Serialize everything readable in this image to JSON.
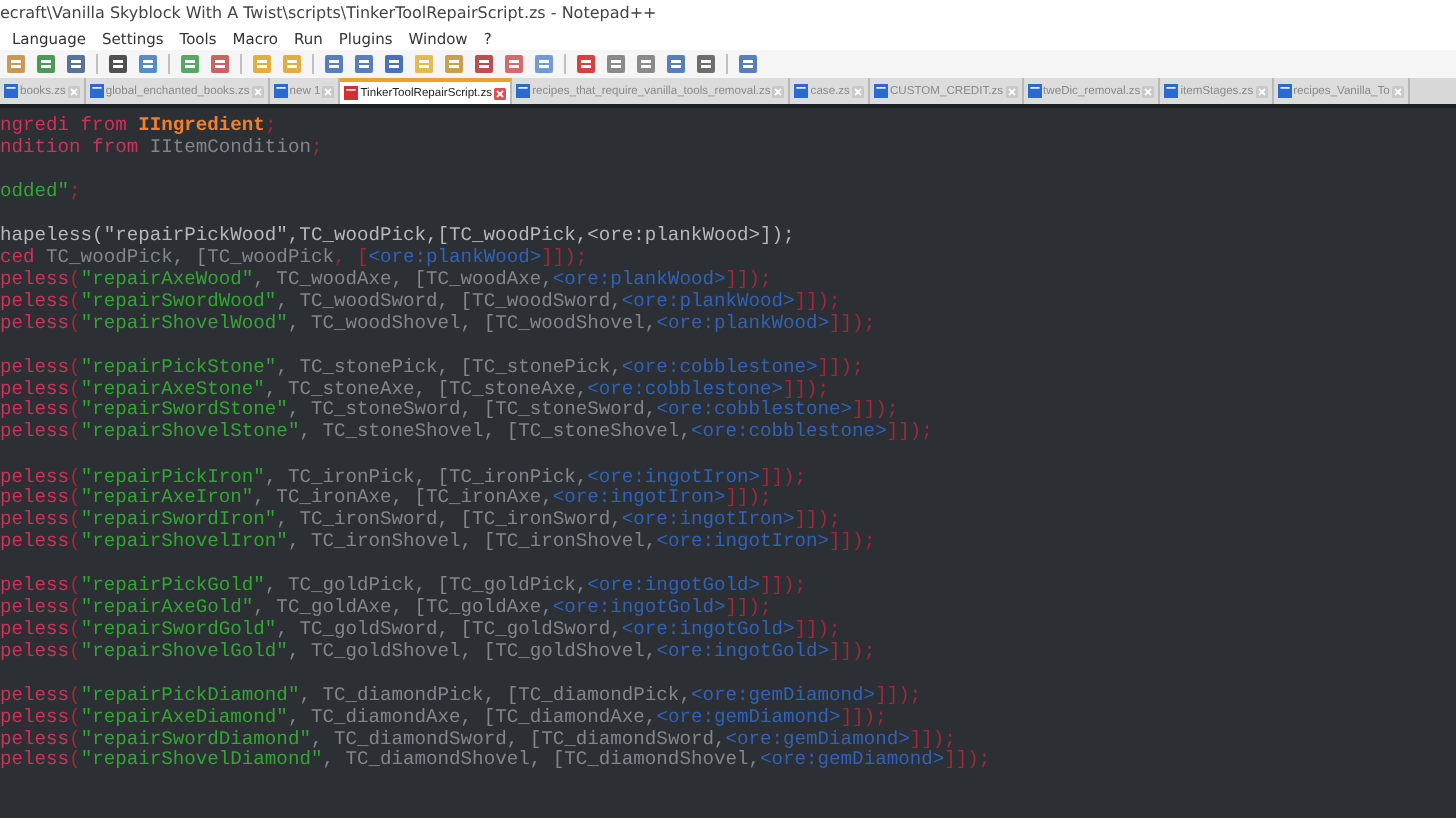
{
  "window": {
    "title": "ecraft\\Vanilla Skyblock With A Twist\\scripts\\TinkerToolRepairScript.zs - Notepad++"
  },
  "menu": [
    "Language",
    "Settings",
    "Tools",
    "Macro",
    "Run",
    "Plugins",
    "Window",
    "?"
  ],
  "tabs": [
    {
      "label": "books.zs",
      "selected": false
    },
    {
      "label": "global_enchanted_books.zs",
      "selected": false
    },
    {
      "label": "new 1",
      "selected": false
    },
    {
      "label": "TinkerToolRepairScript.zs",
      "selected": true
    },
    {
      "label": "recipes_that_require_vanilla_tools_removal.zs",
      "selected": false
    },
    {
      "label": "case.zs",
      "selected": false
    },
    {
      "label": "CUSTOM_CREDIT.zs",
      "selected": false
    },
    {
      "label": "tweDic_removal.zs",
      "selected": false
    },
    {
      "label": "itemStages.zs",
      "selected": false
    },
    {
      "label": "recipes_Vanilla_To",
      "selected": false
    }
  ],
  "code_blocks": [
    [
      [
        {
          "kind": "keyword",
          "text": "ngredi"
        },
        {
          "kind": "keyword",
          "text": " from "
        },
        {
          "kind": "type",
          "text": "IIngredient"
        },
        {
          "kind": "punct",
          "text": ";"
        }
      ],
      [
        {
          "kind": "keyword",
          "text": "ndition"
        },
        {
          "kind": "keyword",
          "text": " from "
        },
        {
          "kind": "plain",
          "text": "IItemCondition"
        },
        {
          "kind": "punct",
          "text": ";"
        }
      ]
    ],
    [
      [
        {
          "kind": "string",
          "text": "odded\""
        },
        {
          "kind": "punct",
          "text": ";"
        }
      ]
    ],
    [
      [
        {
          "kind": "comment",
          "text": "hapeless(\"repairPickWood\",TC_woodPick,[TC_woodPick,<ore:plankWood>]);"
        }
      ],
      [
        {
          "kind": "keyword",
          "text": "ced"
        },
        {
          "kind": "plain",
          "text": " TC_woodPick, [TC_woodPick"
        },
        {
          "kind": "punct",
          "text": ", ["
        },
        {
          "kind": "ore",
          "text": "<ore:plankWood>"
        },
        {
          "kind": "punct",
          "text": "]]);"
        }
      ],
      [
        {
          "kind": "keyword",
          "text": "peless"
        },
        {
          "kind": "punct",
          "text": "("
        },
        {
          "kind": "string",
          "text": "\"repairAxeWood\""
        },
        {
          "kind": "plain",
          "text": ", TC_woodAxe, [TC_woodAxe,"
        },
        {
          "kind": "ore",
          "text": "<ore:plankWood>"
        },
        {
          "kind": "punct",
          "text": "]]);"
        }
      ],
      [
        {
          "kind": "keyword",
          "text": "peless"
        },
        {
          "kind": "punct",
          "text": "("
        },
        {
          "kind": "string",
          "text": "\"repairSwordWood\""
        },
        {
          "kind": "plain",
          "text": ", TC_woodSword, [TC_woodSword,"
        },
        {
          "kind": "ore",
          "text": "<ore:plankWood>"
        },
        {
          "kind": "punct",
          "text": "]]);"
        }
      ],
      [
        {
          "kind": "keyword",
          "text": "peless"
        },
        {
          "kind": "punct",
          "text": "("
        },
        {
          "kind": "string",
          "text": "\"repairShovelWood\""
        },
        {
          "kind": "plain",
          "text": ", TC_woodShovel, [TC_woodShovel,"
        },
        {
          "kind": "ore",
          "text": "<ore:plankWood>"
        },
        {
          "kind": "punct",
          "text": "]]);"
        }
      ]
    ],
    [
      [
        {
          "kind": "keyword",
          "text": "peless"
        },
        {
          "kind": "punct",
          "text": "("
        },
        {
          "kind": "string",
          "text": "\"repairPickStone\""
        },
        {
          "kind": "plain",
          "text": ", TC_stonePick, [TC_stonePick,"
        },
        {
          "kind": "ore",
          "text": "<ore:cobblestone>"
        },
        {
          "kind": "punct",
          "text": "]]);"
        }
      ],
      [
        {
          "kind": "keyword",
          "text": "peless"
        },
        {
          "kind": "punct",
          "text": "("
        },
        {
          "kind": "string",
          "text": "\"repairAxeStone\""
        },
        {
          "kind": "plain",
          "text": ", TC_stoneAxe, [TC_stoneAxe,"
        },
        {
          "kind": "ore",
          "text": "<ore:cobblestone>"
        },
        {
          "kind": "punct",
          "text": "]]);"
        }
      ],
      [
        {
          "kind": "keyword",
          "text": "peless"
        },
        {
          "kind": "punct",
          "text": "("
        },
        {
          "kind": "string",
          "text": "\"repairSwordStone\""
        },
        {
          "kind": "plain",
          "text": ", TC_stoneSword, [TC_stoneSword,"
        },
        {
          "kind": "ore",
          "text": "<ore:cobblestone>"
        },
        {
          "kind": "punct",
          "text": "]]);"
        }
      ],
      [
        {
          "kind": "keyword",
          "text": "peless"
        },
        {
          "kind": "punct",
          "text": "("
        },
        {
          "kind": "string",
          "text": "\"repairShovelStone\""
        },
        {
          "kind": "plain",
          "text": ", TC_stoneShovel, [TC_stoneShovel,"
        },
        {
          "kind": "ore",
          "text": "<ore:cobblestone>"
        },
        {
          "kind": "punct",
          "text": "]]);"
        }
      ]
    ],
    [
      [
        {
          "kind": "keyword",
          "text": "peless"
        },
        {
          "kind": "punct",
          "text": "("
        },
        {
          "kind": "string",
          "text": "\"repairPickIron\""
        },
        {
          "kind": "plain",
          "text": ", TC_ironPick, [TC_ironPick,"
        },
        {
          "kind": "ore",
          "text": "<ore:ingotIron>"
        },
        {
          "kind": "punct",
          "text": "]]);"
        }
      ],
      [
        {
          "kind": "keyword",
          "text": "peless"
        },
        {
          "kind": "punct",
          "text": "("
        },
        {
          "kind": "string",
          "text": "\"repairAxeIron\""
        },
        {
          "kind": "plain",
          "text": ", TC_ironAxe, [TC_ironAxe,"
        },
        {
          "kind": "ore",
          "text": "<ore:ingotIron>"
        },
        {
          "kind": "punct",
          "text": "]]);"
        }
      ],
      [
        {
          "kind": "keyword",
          "text": "peless"
        },
        {
          "kind": "punct",
          "text": "("
        },
        {
          "kind": "string",
          "text": "\"repairSwordIron\""
        },
        {
          "kind": "plain",
          "text": ", TC_ironSword, [TC_ironSword,"
        },
        {
          "kind": "ore",
          "text": "<ore:ingotIron>"
        },
        {
          "kind": "punct",
          "text": "]]);"
        }
      ],
      [
        {
          "kind": "keyword",
          "text": "peless"
        },
        {
          "kind": "punct",
          "text": "("
        },
        {
          "kind": "string",
          "text": "\"repairShovelIron\""
        },
        {
          "kind": "plain",
          "text": ", TC_ironShovel, [TC_ironShovel,"
        },
        {
          "kind": "ore",
          "text": "<ore:ingotIron>"
        },
        {
          "kind": "punct",
          "text": "]]);"
        }
      ]
    ],
    [
      [
        {
          "kind": "keyword",
          "text": "peless"
        },
        {
          "kind": "punct",
          "text": "("
        },
        {
          "kind": "string",
          "text": "\"repairPickGold\""
        },
        {
          "kind": "plain",
          "text": ", TC_goldPick, [TC_goldPick,"
        },
        {
          "kind": "ore",
          "text": "<ore:ingotGold>"
        },
        {
          "kind": "punct",
          "text": "]]);"
        }
      ],
      [
        {
          "kind": "keyword",
          "text": "peless"
        },
        {
          "kind": "punct",
          "text": "("
        },
        {
          "kind": "string",
          "text": "\"repairAxeGold\""
        },
        {
          "kind": "plain",
          "text": ", TC_goldAxe, [TC_goldAxe,"
        },
        {
          "kind": "ore",
          "text": "<ore:ingotGold>"
        },
        {
          "kind": "punct",
          "text": "]]);"
        }
      ],
      [
        {
          "kind": "keyword",
          "text": "peless"
        },
        {
          "kind": "punct",
          "text": "("
        },
        {
          "kind": "string",
          "text": "\"repairSwordGold\""
        },
        {
          "kind": "plain",
          "text": ", TC_goldSword, [TC_goldSword,"
        },
        {
          "kind": "ore",
          "text": "<ore:ingotGold>"
        },
        {
          "kind": "punct",
          "text": "]]);"
        }
      ],
      [
        {
          "kind": "keyword",
          "text": "peless"
        },
        {
          "kind": "punct",
          "text": "("
        },
        {
          "kind": "string",
          "text": "\"repairShovelGold\""
        },
        {
          "kind": "plain",
          "text": ", TC_goldShovel, [TC_goldShovel,"
        },
        {
          "kind": "ore",
          "text": "<ore:ingotGold>"
        },
        {
          "kind": "punct",
          "text": "]]);"
        }
      ]
    ],
    [
      [
        {
          "kind": "keyword",
          "text": "peless"
        },
        {
          "kind": "punct",
          "text": "("
        },
        {
          "kind": "string",
          "text": "\"repairPickDiamond\""
        },
        {
          "kind": "plain",
          "text": ", TC_diamondPick, [TC_diamondPick,"
        },
        {
          "kind": "ore",
          "text": "<ore:gemDiamond>"
        },
        {
          "kind": "punct",
          "text": "]]);"
        }
      ],
      [
        {
          "kind": "keyword",
          "text": "peless"
        },
        {
          "kind": "punct",
          "text": "("
        },
        {
          "kind": "string",
          "text": "\"repairAxeDiamond\""
        },
        {
          "kind": "plain",
          "text": ", TC_diamondAxe, [TC_diamondAxe,"
        },
        {
          "kind": "ore",
          "text": "<ore:gemDiamond>"
        },
        {
          "kind": "punct",
          "text": "]]);"
        }
      ],
      [
        {
          "kind": "keyword",
          "text": "peless"
        },
        {
          "kind": "punct",
          "text": "("
        },
        {
          "kind": "string",
          "text": "\"repairSwordDiamond\""
        },
        {
          "kind": "plain",
          "text": ", TC_diamondSword, [TC_diamondSword,"
        },
        {
          "kind": "ore",
          "text": "<ore:gemDiamond>"
        },
        {
          "kind": "punct",
          "text": "]]);"
        }
      ],
      [
        {
          "kind": "keyword",
          "text": "peless"
        },
        {
          "kind": "punct",
          "text": "("
        },
        {
          "kind": "string",
          "text": "\"repairShovelDiamond\""
        },
        {
          "kind": "plain",
          "text": ", TC_diamondShovel, [TC_diamondShovel,"
        },
        {
          "kind": "ore",
          "text": "<ore:gemDiamond>"
        },
        {
          "kind": "punct",
          "text": "]]);"
        }
      ]
    ]
  ]
}
